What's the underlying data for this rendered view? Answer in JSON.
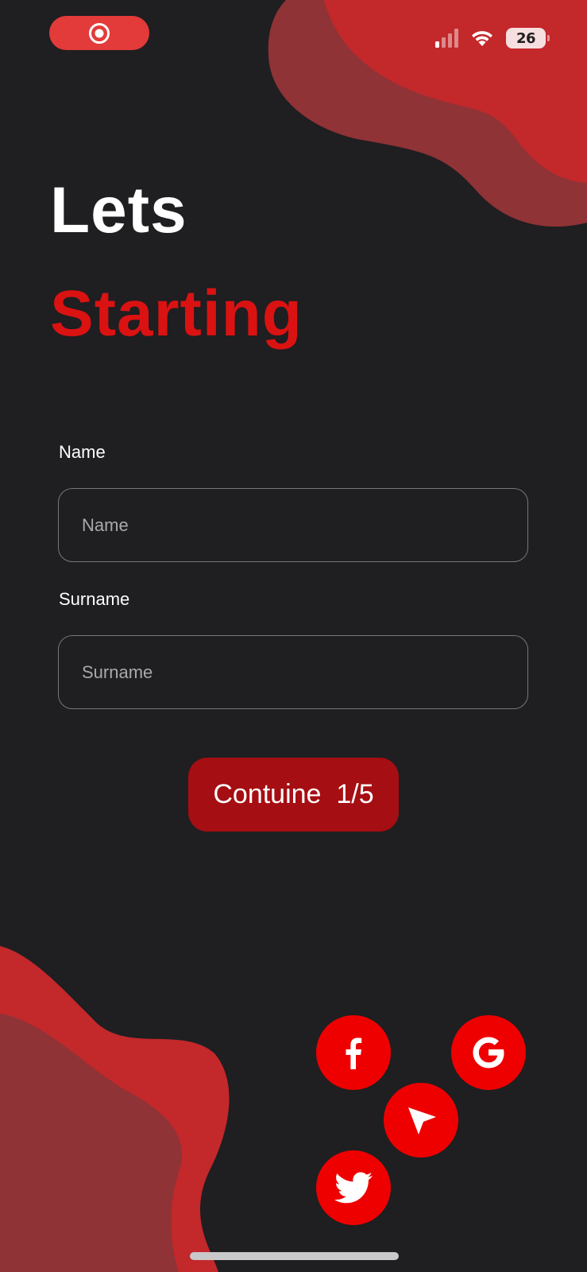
{
  "status_bar": {
    "battery_level": "26",
    "recording_icon": "record-icon",
    "signal_icon": "cellular-signal-icon",
    "wifi_icon": "wifi-icon"
  },
  "heading": {
    "line1": "Lets",
    "line2": "Starting"
  },
  "form": {
    "name_label": "Name",
    "name_placeholder": "Name",
    "name_value": "",
    "surname_label": "Surname",
    "surname_placeholder": "Surname",
    "surname_value": ""
  },
  "continue_button": {
    "label": "Contuine  1/5"
  },
  "social_buttons": [
    {
      "icon": "facebook-icon"
    },
    {
      "icon": "google-icon"
    },
    {
      "icon": "location-arrow-icon"
    },
    {
      "icon": "twitter-icon"
    }
  ],
  "colors": {
    "background": "#1f1e21",
    "accent_red": "#da1212",
    "button_red": "#a50e12",
    "social_red": "#ef0000",
    "blob_light": "#c3282b",
    "blob_dark": "#8f3336"
  }
}
